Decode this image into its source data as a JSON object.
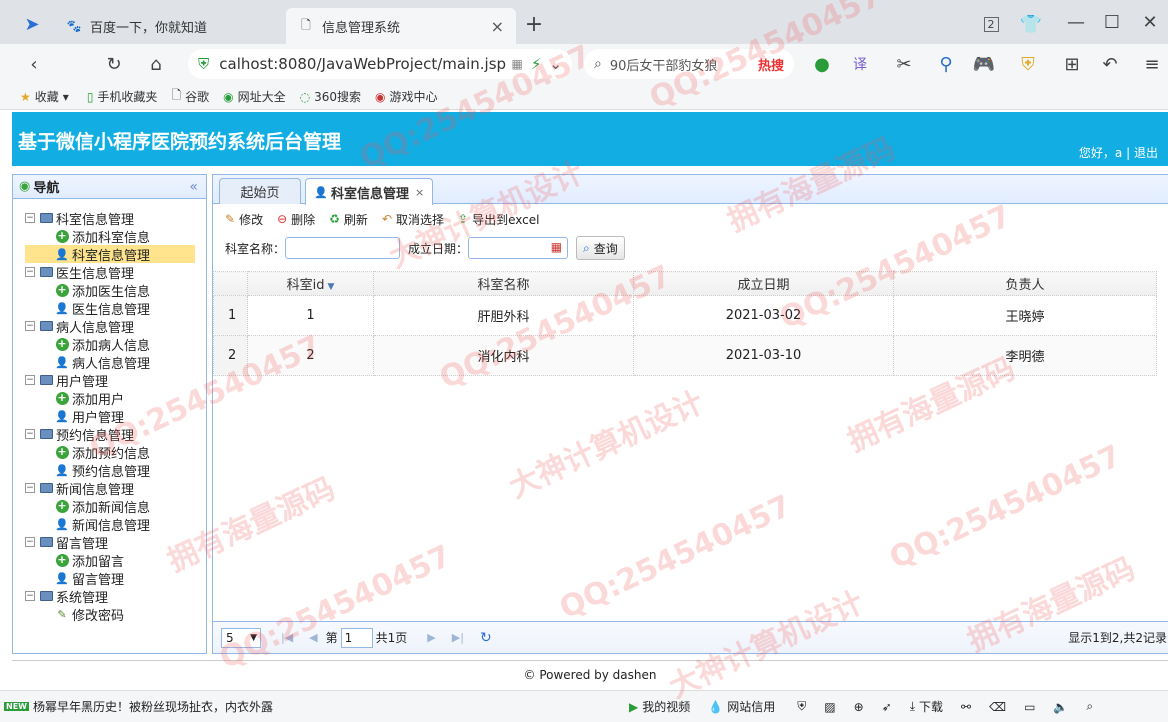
{
  "browser": {
    "tabs": [
      {
        "label": "百度一下，你就知道",
        "icon": "baidu-paw-icon"
      },
      {
        "label": "信息管理系统",
        "icon": "page-icon"
      }
    ],
    "address": "calhost:8080/JavaWebProject/main.jsp",
    "search_text": "90后女干部豹女狼",
    "hot_label": "热搜",
    "tab_count": "2",
    "bookmarks": [
      "收藏",
      "手机收藏夹",
      "谷歌",
      "网址大全",
      "360搜索",
      "游戏中心"
    ]
  },
  "header": {
    "title": "基于微信小程序医院预约系统后台管理",
    "greeting": "您好，a",
    "separator": "|",
    "logout": "退出"
  },
  "nav": {
    "title": "导航",
    "collapse_icon": "«",
    "groups": [
      {
        "label": "科室信息管理",
        "children": [
          "添加科室信息",
          "科室信息管理"
        ]
      },
      {
        "label": "医生信息管理",
        "children": [
          "添加医生信息",
          "医生信息管理"
        ]
      },
      {
        "label": "病人信息管理",
        "children": [
          "添加病人信息",
          "病人信息管理"
        ]
      },
      {
        "label": "用户管理",
        "children": [
          "添加用户",
          "用户管理"
        ]
      },
      {
        "label": "预约信息管理",
        "children": [
          "添加预约信息",
          "预约信息管理"
        ]
      },
      {
        "label": "新闻信息管理",
        "children": [
          "添加新闻信息",
          "新闻信息管理"
        ]
      },
      {
        "label": "留言管理",
        "children": [
          "添加留言",
          "留言管理"
        ]
      },
      {
        "label": "系统管理",
        "children": [
          "修改密码"
        ]
      }
    ]
  },
  "tabs": {
    "home": "起始页",
    "current": "科室信息管理",
    "close": "×"
  },
  "toolbar": {
    "edit": "修改",
    "delete": "删除",
    "refresh": "刷新",
    "unselect": "取消选择",
    "export": "导出到excel"
  },
  "filter": {
    "name_label": "科室名称：",
    "date_label": "成立日期：",
    "query": "查询"
  },
  "grid": {
    "columns": [
      "科室id",
      "科室名称",
      "成立日期",
      "负责人"
    ],
    "rows": [
      {
        "rn": "1",
        "id": "1",
        "name": "肝胆外科",
        "date": "2021-03-02",
        "head": "王晓婷"
      },
      {
        "rn": "2",
        "id": "2",
        "name": "消化内科",
        "date": "2021-03-10",
        "head": "李明德"
      }
    ]
  },
  "pager": {
    "page_size": "5",
    "page_prefix": "第",
    "page_num": "1",
    "page_suffix": "共1页",
    "info": "显示1到2,共2记录"
  },
  "footer": "© Powered by dashen",
  "statusbar": {
    "news": "杨幂早年黑历史！被粉丝现场扯衣，内衣外露",
    "new_badge": "NEW",
    "video": "我的视频",
    "credit": "网站信用",
    "download": "下载"
  },
  "watermark": {
    "qq": "QQ:254540457",
    "a": "拥有海量源码",
    "b": "大神计算机设计"
  }
}
